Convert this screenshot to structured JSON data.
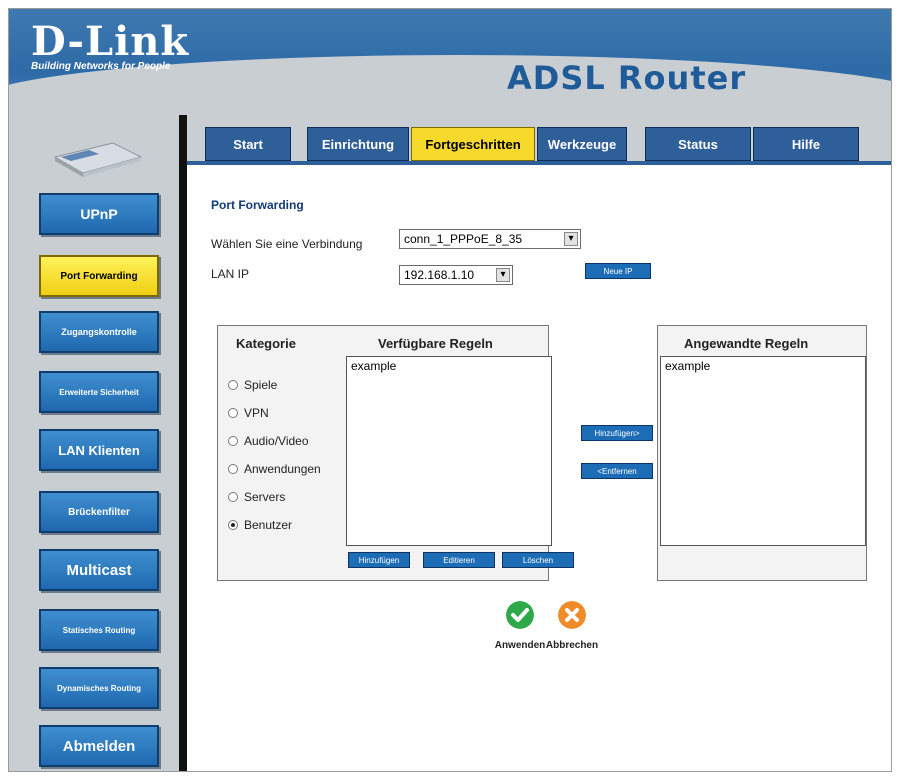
{
  "branding": {
    "brand": "D-Link",
    "tagline": "Building Networks for People",
    "title": "ADSL Router"
  },
  "tabs": [
    {
      "label": "Start",
      "active": false
    },
    {
      "label": "Einrichtung",
      "active": false
    },
    {
      "label": "Fortgeschritten",
      "active": true
    },
    {
      "label": "Werkzeuge",
      "active": false
    },
    {
      "label": "Status",
      "active": false
    },
    {
      "label": "Hilfe",
      "active": false
    }
  ],
  "sidebar": {
    "items": [
      {
        "label": "UPnP",
        "active": false
      },
      {
        "label": "Port Forwarding",
        "active": true
      },
      {
        "label": "Zugangskontrolle",
        "active": false
      },
      {
        "label": "Erweiterte Sicherheit",
        "active": false
      },
      {
        "label": "LAN Klienten",
        "active": false
      },
      {
        "label": "Brückenfilter",
        "active": false
      },
      {
        "label": "Multicast",
        "active": false
      },
      {
        "label": "Statisches Routing",
        "active": false
      },
      {
        "label": "Dynamisches Routing",
        "active": false
      },
      {
        "label": "Abmelden",
        "active": false
      }
    ]
  },
  "port_forwarding": {
    "title": "Port Forwarding",
    "connection_label": "Wählen Sie eine Verbindung",
    "connection_value": "conn_1_PPPoE_8_35",
    "lan_ip_label": "LAN IP",
    "lan_ip_value": "192.168.1.10",
    "new_ip_button": "Neue IP"
  },
  "rules": {
    "category_header": "Kategorie",
    "available_header": "Verfügbare Regeln",
    "applied_header": "Angewandte Regeln",
    "categories": [
      {
        "label": "Spiele",
        "checked": false
      },
      {
        "label": "VPN",
        "checked": false
      },
      {
        "label": "Audio/Video",
        "checked": false
      },
      {
        "label": "Anwendungen",
        "checked": false
      },
      {
        "label": "Servers",
        "checked": false
      },
      {
        "label": "Benutzer",
        "checked": true
      }
    ],
    "available_items": [
      "example"
    ],
    "applied_items": [
      "example"
    ],
    "add_button": "Hinzufügen>",
    "remove_button": "<Entfernen",
    "new_rule_button": "Hinzufügen",
    "edit_button": "Editieren",
    "delete_button": "Löschen"
  },
  "actions": {
    "apply": "Anwenden",
    "cancel": "Abbrechen"
  },
  "colors": {
    "accent_blue": "#1f68ae",
    "active_yellow": "#f6d92b",
    "apply_green": "#2fa84a",
    "cancel_orange": "#f08b2a"
  }
}
